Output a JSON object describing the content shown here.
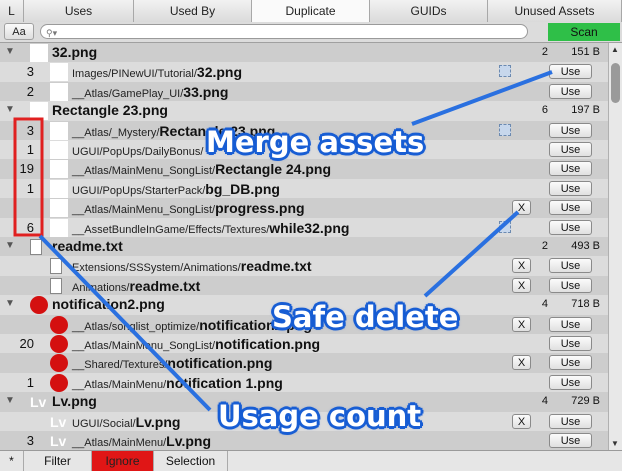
{
  "tabs": [
    "L",
    "Uses",
    "Used By",
    "Duplicate",
    "GUIDs",
    "Unused Assets"
  ],
  "toolbar": {
    "aa_label": "Aa",
    "search_placeholder": "",
    "scan_label": "Scan"
  },
  "rows": [
    {
      "kind": "group",
      "name": "32.png",
      "count": "2",
      "size": "151 B",
      "thumb": "white"
    },
    {
      "kind": "item",
      "count": "3",
      "path": "Images/PINewUI/Tutorial/",
      "file": "32.png",
      "thumb": "white",
      "cube": true,
      "x": false,
      "use": "Use"
    },
    {
      "kind": "item",
      "count": "2",
      "path": "__Atlas/GamePlay_UI/",
      "file": "33.png",
      "thumb": "white",
      "cube": false,
      "x": false,
      "use": "Use"
    },
    {
      "kind": "group",
      "name": "Rectangle 23.png",
      "count": "6",
      "size": "197 B",
      "thumb": "white"
    },
    {
      "kind": "item",
      "count": "3",
      "path": "__Atlas/_Mystery/",
      "file": "Rectangle 23.png",
      "thumb": "white",
      "cube": true,
      "x": false,
      "use": "Use"
    },
    {
      "kind": "item",
      "count": "1",
      "path": "UGUI/PopUps/DailyBonus/",
      "file": "",
      "thumb": "white",
      "cube": false,
      "x": false,
      "use": "Use"
    },
    {
      "kind": "item",
      "count": "19",
      "path": "__Atlas/MainMenu_SongList/",
      "file": "Rectangle 24.png",
      "thumb": "white",
      "cube": false,
      "x": false,
      "use": "Use"
    },
    {
      "kind": "item",
      "count": "1",
      "path": "UGUI/PopUps/StarterPack/",
      "file": "bg_DB.png",
      "thumb": "white",
      "cube": false,
      "x": false,
      "use": "Use"
    },
    {
      "kind": "item",
      "count": "",
      "path": "__Atlas/MainMenu_SongList/",
      "file": "progress.png",
      "thumb": "white",
      "cube": false,
      "x": true,
      "use": "Use"
    },
    {
      "kind": "item",
      "count": "6",
      "path": "__AssetBundleInGame/Effects/Textures/",
      "file": "while32.png",
      "thumb": "white",
      "cube": true,
      "x": false,
      "use": "Use"
    },
    {
      "kind": "group",
      "name": "readme.txt",
      "count": "2",
      "size": "493 B",
      "thumb": "doc"
    },
    {
      "kind": "item",
      "count": "",
      "path": "Extensions/SSSystem/Animations/",
      "file": "readme.txt",
      "thumb": "doc",
      "cube": false,
      "x": true,
      "use": "Use"
    },
    {
      "kind": "item",
      "count": "",
      "path": "Animations/",
      "file": "readme.txt",
      "thumb": "doc",
      "cube": false,
      "x": true,
      "use": "Use"
    },
    {
      "kind": "group",
      "name": "notification2.png",
      "count": "4",
      "size": "718 B",
      "thumb": "red"
    },
    {
      "kind": "item",
      "count": "",
      "path": "__Atlas/songlist_optimize/",
      "file": "notification2.png",
      "thumb": "red",
      "cube": false,
      "x": true,
      "use": "Use"
    },
    {
      "kind": "item",
      "count": "20",
      "path": "__Atlas/MainMenu_SongList/",
      "file": "notification.png",
      "thumb": "red",
      "cube": false,
      "x": false,
      "use": "Use"
    },
    {
      "kind": "item",
      "count": "",
      "path": "__Shared/Textures/",
      "file": "notification.png",
      "thumb": "red",
      "cube": false,
      "x": true,
      "use": "Use"
    },
    {
      "kind": "item",
      "count": "1",
      "path": "__Atlas/MainMenu/",
      "file": "notification 1.png",
      "thumb": "red",
      "cube": false,
      "x": false,
      "use": "Use"
    },
    {
      "kind": "group",
      "name": "Lv.png",
      "count": "4",
      "size": "729 B",
      "thumb": "lv"
    },
    {
      "kind": "item",
      "count": "",
      "path": "UGUI/Social/",
      "file": "Lv.png",
      "thumb": "lv",
      "cube": false,
      "x": true,
      "use": "Use"
    },
    {
      "kind": "item",
      "count": "3",
      "path": "__Atlas/MainMenu/",
      "file": "Lv.png",
      "thumb": "lv",
      "cube": false,
      "x": false,
      "use": "Use"
    }
  ],
  "bottom": [
    "*",
    "Filter",
    "Ignore",
    "Selection"
  ],
  "annotations": [
    "Merge assets",
    "Safe delete",
    "Usage count"
  ],
  "colors": {
    "scan": "#2fbf48",
    "ignore": "#e01616",
    "annotation": "#1a5fd4",
    "highlight_box": "#e02020"
  }
}
